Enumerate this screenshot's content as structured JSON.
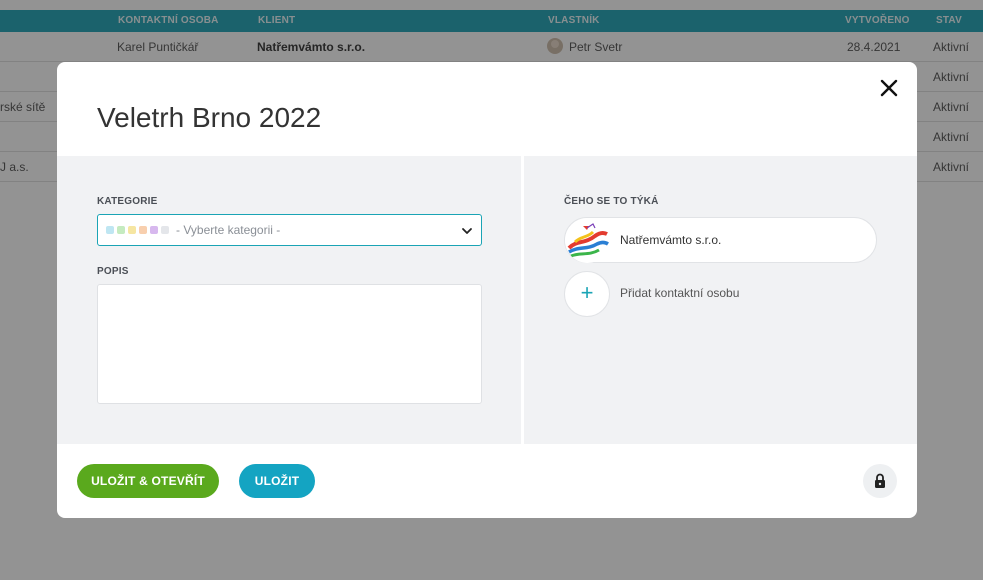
{
  "table": {
    "headers": {
      "contact": "KONTAKTNÍ OSOBA",
      "client": "KLIENT",
      "owner": "VLASTNÍK",
      "created": "VYTVOŘENO",
      "status": "STAV"
    },
    "rows": [
      {
        "left": "",
        "contact": "Karel Puntičkář",
        "client": "Natřemvámto s.r.o.",
        "owner": "Petr Svetr",
        "created": "28.4.2021",
        "status": "Aktivní"
      },
      {
        "left": "",
        "status": "Aktivní"
      },
      {
        "left": "rské sítě",
        "status": "Aktivní"
      },
      {
        "left": "",
        "status": "Aktivní"
      },
      {
        "left": "J a.s.",
        "status": "Aktivní"
      }
    ]
  },
  "modal": {
    "title": "Veletrh Brno 2022",
    "category": {
      "label": "KATEGORIE",
      "placeholder": "- Vyberte kategorii -",
      "swatch_colors": [
        "#bfe6f2",
        "#c5ebc0",
        "#f6e6a2",
        "#f8cfae",
        "#d7b8ee",
        "#e4e6ea"
      ]
    },
    "description": {
      "label": "POPIS",
      "value": ""
    },
    "related": {
      "label": "ČEHO SE TO TÝKÁ",
      "company": "Natřemvámto s.r.o.",
      "add_contact": "Přidat kontaktní osobu"
    },
    "buttons": {
      "save_open": "ULOŽIT & OTEVŘÍT",
      "save": "ULOŽIT"
    },
    "icons": {
      "close": "close-icon",
      "chevron": "chevron-down-icon",
      "plus": "plus-icon",
      "lock": "lock-icon"
    }
  },
  "colors": {
    "header_teal": "#0f9db1",
    "accent": "#14a4c2",
    "green": "#5aa91d"
  }
}
